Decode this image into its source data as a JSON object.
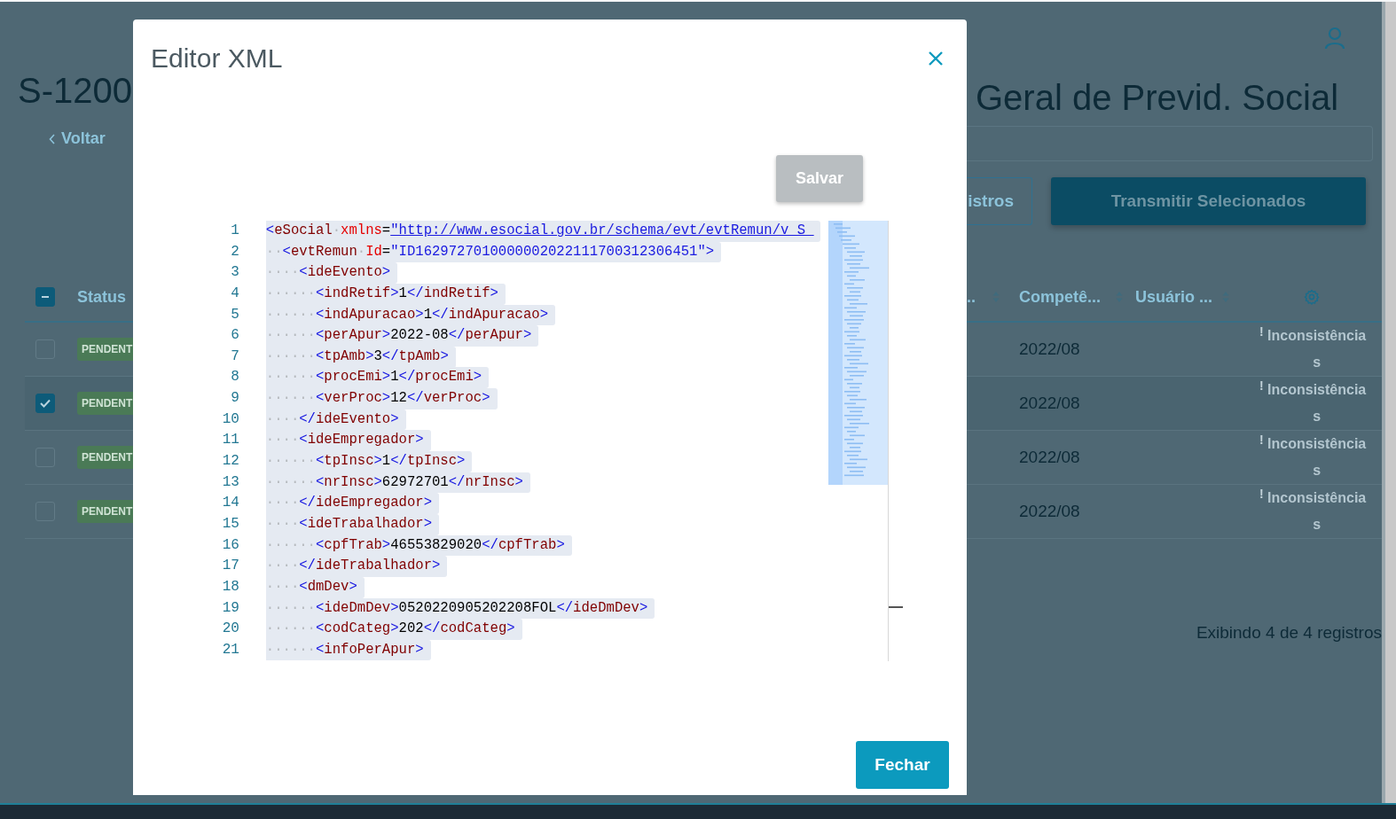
{
  "page": {
    "title_left": "S-1200",
    "title_right": "Geral de Previd. Social",
    "back_link": "Voltar",
    "buttons": [
      {
        "label": "istros",
        "kind": "outline"
      },
      {
        "label": "Transmitir Selecionados",
        "kind": "primary"
      }
    ],
    "table": {
      "header_checkbox": {
        "indeterminate": true
      },
      "columns_left": [
        {
          "label": "Status"
        }
      ],
      "columns_right": [
        {
          "label": "..",
          "sortable": true
        },
        {
          "label": "Competê...",
          "sortable": true
        },
        {
          "label": "Usuário ...",
          "sortable": true
        }
      ],
      "rows": [
        {
          "checked": false,
          "status": "PENDENT",
          "competencia": "2022/08",
          "alert": "!",
          "action": "Inconsistências"
        },
        {
          "checked": true,
          "status": "PENDENT",
          "competencia": "2022/08",
          "alert": "!",
          "action": "Inconsistências"
        },
        {
          "checked": false,
          "status": "PENDENT",
          "competencia": "2022/08",
          "alert": "!",
          "action": "Inconsistências"
        },
        {
          "checked": false,
          "status": "PENDENT",
          "competencia": "2022/08",
          "alert": "!",
          "action": "Inconsistências"
        }
      ]
    },
    "footer": "Exibindo 4 de 4 registros"
  },
  "modal": {
    "title": "Editor XML",
    "save_button": {
      "label": "Salvar",
      "disabled": true
    },
    "close_button": "Fechar",
    "lines": [
      {
        "number": "1",
        "tokens": [
          {
            "kind": "p",
            "text": "<"
          },
          {
            "kind": "tag",
            "text": "eSocial"
          },
          {
            "kind": "ws",
            "text": "·"
          },
          {
            "kind": "attr",
            "text": "xmlns"
          },
          {
            "kind": "eq",
            "text": "="
          },
          {
            "kind": "link",
            "text": "\"http://www.esocial.gov.br/schema/evt/evtRemun/v_S_"
          }
        ]
      },
      {
        "number": "2",
        "tokens": [
          {
            "kind": "ws",
            "text": "··"
          },
          {
            "kind": "p",
            "text": "<"
          },
          {
            "kind": "tag",
            "text": "evtRemun"
          },
          {
            "kind": "ws",
            "text": "·"
          },
          {
            "kind": "attr",
            "text": "Id"
          },
          {
            "kind": "eq",
            "text": "="
          },
          {
            "kind": "val",
            "text": "\"ID1629727010000002022111700312306451\""
          },
          {
            "kind": "p",
            "text": ">"
          }
        ]
      },
      {
        "number": "3",
        "tokens": [
          {
            "kind": "ws",
            "text": "····"
          },
          {
            "kind": "p",
            "text": "<"
          },
          {
            "kind": "tag",
            "text": "ideEvento"
          },
          {
            "kind": "p",
            "text": ">"
          }
        ]
      },
      {
        "number": "4",
        "tokens": [
          {
            "kind": "ws",
            "text": "······"
          },
          {
            "kind": "p",
            "text": "<"
          },
          {
            "kind": "tag",
            "text": "indRetif"
          },
          {
            "kind": "p",
            "text": ">"
          },
          {
            "kind": "txt",
            "text": "1"
          },
          {
            "kind": "p",
            "text": "</"
          },
          {
            "kind": "tag",
            "text": "indRetif"
          },
          {
            "kind": "p",
            "text": ">"
          }
        ]
      },
      {
        "number": "5",
        "tokens": [
          {
            "kind": "ws",
            "text": "······"
          },
          {
            "kind": "p",
            "text": "<"
          },
          {
            "kind": "tag",
            "text": "indApuracao"
          },
          {
            "kind": "p",
            "text": ">"
          },
          {
            "kind": "txt",
            "text": "1"
          },
          {
            "kind": "p",
            "text": "</"
          },
          {
            "kind": "tag",
            "text": "indApuracao"
          },
          {
            "kind": "p",
            "text": ">"
          }
        ]
      },
      {
        "number": "6",
        "tokens": [
          {
            "kind": "ws",
            "text": "······"
          },
          {
            "kind": "p",
            "text": "<"
          },
          {
            "kind": "tag",
            "text": "perApur"
          },
          {
            "kind": "p",
            "text": ">"
          },
          {
            "kind": "txt",
            "text": "2022-08"
          },
          {
            "kind": "p",
            "text": "</"
          },
          {
            "kind": "tag",
            "text": "perApur"
          },
          {
            "kind": "p",
            "text": ">"
          }
        ]
      },
      {
        "number": "7",
        "tokens": [
          {
            "kind": "ws",
            "text": "······"
          },
          {
            "kind": "p",
            "text": "<"
          },
          {
            "kind": "tag",
            "text": "tpAmb"
          },
          {
            "kind": "p",
            "text": ">"
          },
          {
            "kind": "txt",
            "text": "3"
          },
          {
            "kind": "p",
            "text": "</"
          },
          {
            "kind": "tag",
            "text": "tpAmb"
          },
          {
            "kind": "p",
            "text": ">"
          }
        ]
      },
      {
        "number": "8",
        "tokens": [
          {
            "kind": "ws",
            "text": "······"
          },
          {
            "kind": "p",
            "text": "<"
          },
          {
            "kind": "tag",
            "text": "procEmi"
          },
          {
            "kind": "p",
            "text": ">"
          },
          {
            "kind": "txt",
            "text": "1"
          },
          {
            "kind": "p",
            "text": "</"
          },
          {
            "kind": "tag",
            "text": "procEmi"
          },
          {
            "kind": "p",
            "text": ">"
          }
        ]
      },
      {
        "number": "9",
        "tokens": [
          {
            "kind": "ws",
            "text": "······"
          },
          {
            "kind": "p",
            "text": "<"
          },
          {
            "kind": "tag",
            "text": "verProc"
          },
          {
            "kind": "p",
            "text": ">"
          },
          {
            "kind": "txt",
            "text": "12"
          },
          {
            "kind": "p",
            "text": "</"
          },
          {
            "kind": "tag",
            "text": "verProc"
          },
          {
            "kind": "p",
            "text": ">"
          }
        ]
      },
      {
        "number": "10",
        "tokens": [
          {
            "kind": "ws",
            "text": "····"
          },
          {
            "kind": "p",
            "text": "</"
          },
          {
            "kind": "tag",
            "text": "ideEvento"
          },
          {
            "kind": "p",
            "text": ">"
          }
        ]
      },
      {
        "number": "11",
        "tokens": [
          {
            "kind": "ws",
            "text": "····"
          },
          {
            "kind": "p",
            "text": "<"
          },
          {
            "kind": "tag",
            "text": "ideEmpregador"
          },
          {
            "kind": "p",
            "text": ">"
          }
        ]
      },
      {
        "number": "12",
        "tokens": [
          {
            "kind": "ws",
            "text": "······"
          },
          {
            "kind": "p",
            "text": "<"
          },
          {
            "kind": "tag",
            "text": "tpInsc"
          },
          {
            "kind": "p",
            "text": ">"
          },
          {
            "kind": "txt",
            "text": "1"
          },
          {
            "kind": "p",
            "text": "</"
          },
          {
            "kind": "tag",
            "text": "tpInsc"
          },
          {
            "kind": "p",
            "text": ">"
          }
        ]
      },
      {
        "number": "13",
        "tokens": [
          {
            "kind": "ws",
            "text": "······"
          },
          {
            "kind": "p",
            "text": "<"
          },
          {
            "kind": "tag",
            "text": "nrInsc"
          },
          {
            "kind": "p",
            "text": ">"
          },
          {
            "kind": "txt",
            "text": "62972701"
          },
          {
            "kind": "p",
            "text": "</"
          },
          {
            "kind": "tag",
            "text": "nrInsc"
          },
          {
            "kind": "p",
            "text": ">"
          }
        ]
      },
      {
        "number": "14",
        "tokens": [
          {
            "kind": "ws",
            "text": "····"
          },
          {
            "kind": "p",
            "text": "</"
          },
          {
            "kind": "tag",
            "text": "ideEmpregador"
          },
          {
            "kind": "p",
            "text": ">"
          }
        ]
      },
      {
        "number": "15",
        "tokens": [
          {
            "kind": "ws",
            "text": "····"
          },
          {
            "kind": "p",
            "text": "<"
          },
          {
            "kind": "tag",
            "text": "ideTrabalhador"
          },
          {
            "kind": "p",
            "text": ">"
          }
        ]
      },
      {
        "number": "16",
        "tokens": [
          {
            "kind": "ws",
            "text": "······"
          },
          {
            "kind": "p",
            "text": "<"
          },
          {
            "kind": "tag",
            "text": "cpfTrab"
          },
          {
            "kind": "p",
            "text": ">"
          },
          {
            "kind": "txt",
            "text": "46553829020"
          },
          {
            "kind": "p",
            "text": "</"
          },
          {
            "kind": "tag",
            "text": "cpfTrab"
          },
          {
            "kind": "p",
            "text": ">"
          }
        ]
      },
      {
        "number": "17",
        "tokens": [
          {
            "kind": "ws",
            "text": "····"
          },
          {
            "kind": "p",
            "text": "</"
          },
          {
            "kind": "tag",
            "text": "ideTrabalhador"
          },
          {
            "kind": "p",
            "text": ">"
          }
        ]
      },
      {
        "number": "18",
        "tokens": [
          {
            "kind": "ws",
            "text": "····"
          },
          {
            "kind": "p",
            "text": "<"
          },
          {
            "kind": "tag",
            "text": "dmDev"
          },
          {
            "kind": "p",
            "text": ">"
          }
        ]
      },
      {
        "number": "19",
        "tokens": [
          {
            "kind": "ws",
            "text": "······"
          },
          {
            "kind": "p",
            "text": "<"
          },
          {
            "kind": "tag",
            "text": "ideDmDev"
          },
          {
            "kind": "p",
            "text": ">"
          },
          {
            "kind": "txt",
            "text": "0520220905202208FOL"
          },
          {
            "kind": "p",
            "text": "</"
          },
          {
            "kind": "tag",
            "text": "ideDmDev"
          },
          {
            "kind": "p",
            "text": ">"
          }
        ]
      },
      {
        "number": "20",
        "tokens": [
          {
            "kind": "ws",
            "text": "······"
          },
          {
            "kind": "p",
            "text": "<"
          },
          {
            "kind": "tag",
            "text": "codCateg"
          },
          {
            "kind": "p",
            "text": ">"
          },
          {
            "kind": "txt",
            "text": "202"
          },
          {
            "kind": "p",
            "text": "</"
          },
          {
            "kind": "tag",
            "text": "codCateg"
          },
          {
            "kind": "p",
            "text": ">"
          }
        ]
      },
      {
        "number": "21",
        "tokens": [
          {
            "kind": "ws",
            "text": "······"
          },
          {
            "kind": "p",
            "text": "<"
          },
          {
            "kind": "tag",
            "text": "infoPerApur"
          },
          {
            "kind": "p",
            "text": ">"
          }
        ]
      }
    ]
  }
}
